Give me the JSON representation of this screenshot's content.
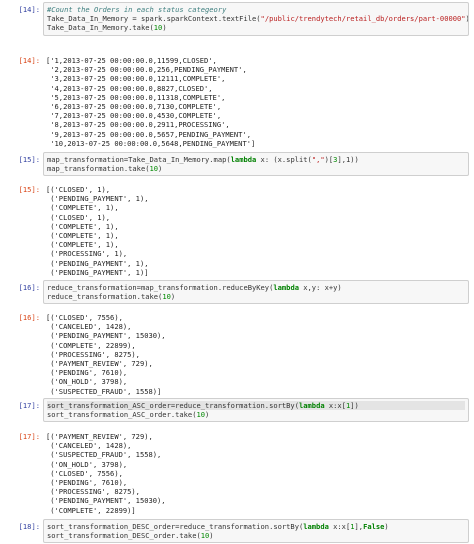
{
  "cells": [
    {
      "kind": "input",
      "prompt": "[14]:",
      "lines": [
        "#Count the Orders in each status categeory",
        "Take_Data_In_Memory = spark.sparkContext.textFile(\"/public/trendytech/retail_db/orders/part-00000\")",
        "Take_Data_In_Memory.take(10)"
      ]
    },
    {
      "kind": "output",
      "prompt": "[14]:",
      "lines": [
        "['1,2013-07-25 00:00:00.0,11599,CLOSED',",
        " '2,2013-07-25 00:00:00.0,256,PENDING_PAYMENT',",
        " '3,2013-07-25 00:00:00.0,12111,COMPLETE',",
        " '4,2013-07-25 00:00:00.0,8827,CLOSED',",
        " '5,2013-07-25 00:00:00.0,11318,COMPLETE',",
        " '6,2013-07-25 00:00:00.0,7130,COMPLETE',",
        " '7,2013-07-25 00:00:00.0,4530,COMPLETE',",
        " '8,2013-07-25 00:00:00.0,2911,PROCESSING',",
        " '9,2013-07-25 00:00:00.0,5657,PENDING_PAYMENT',",
        " '10,2013-07-25 00:00:00.0,5648,PENDING_PAYMENT']"
      ]
    },
    {
      "kind": "input",
      "prompt": "[15]:",
      "lines": [
        "map_transformation=Take_Data_In_Memory.map(lambda x: (x.split(\",\")[3],1))",
        "map_transformation.take(10)"
      ]
    },
    {
      "kind": "output",
      "prompt": "[15]:",
      "lines": [
        "[('CLOSED', 1),",
        " ('PENDING_PAYMENT', 1),",
        " ('COMPLETE', 1),",
        " ('CLOSED', 1),",
        " ('COMPLETE', 1),",
        " ('COMPLETE', 1),",
        " ('COMPLETE', 1),",
        " ('PROCESSING', 1),",
        " ('PENDING_PAYMENT', 1),",
        " ('PENDING_PAYMENT', 1)]"
      ]
    },
    {
      "kind": "input",
      "prompt": "[16]:",
      "lines": [
        "reduce_transformation=map_transformation.reduceByKey(lambda x,y: x+y)",
        "reduce_transformation.take(10)"
      ]
    },
    {
      "kind": "output",
      "prompt": "[16]:",
      "lines": [
        "[('CLOSED', 7556),",
        " ('CANCELED', 1428),",
        " ('PENDING_PAYMENT', 15030),",
        " ('COMPLETE', 22899),",
        " ('PROCESSING', 8275),",
        " ('PAYMENT_REVIEW', 729),",
        " ('PENDING', 7610),",
        " ('ON_HOLD', 3798),",
        " ('SUSPECTED_FRAUD', 1558)]"
      ]
    },
    {
      "kind": "input",
      "prompt": "[17]:",
      "lines": [
        "sort_transformation_ASC_order=reduce_transformation.sortBy(lambda x:x[1])",
        "sort_transformation_ASC_order.take(10)"
      ]
    },
    {
      "kind": "output",
      "prompt": "[17]:",
      "lines": [
        "[('PAYMENT_REVIEW', 729),",
        " ('CANCELED', 1428),",
        " ('SUSPECTED_FRAUD', 1558),",
        " ('ON_HOLD', 3798),",
        " ('CLOSED', 7556),",
        " ('PENDING', 7610),",
        " ('PROCESSING', 8275),",
        " ('PENDING_PAYMENT', 15030),",
        " ('COMPLETE', 22899)]"
      ]
    },
    {
      "kind": "input",
      "prompt": "[18]:",
      "lines": [
        "sort_transformation_DESC_order=reduce_transformation.sortBy(lambda x:x[1],False)",
        "sort_transformation_DESC_order.take(10)"
      ]
    }
  ]
}
